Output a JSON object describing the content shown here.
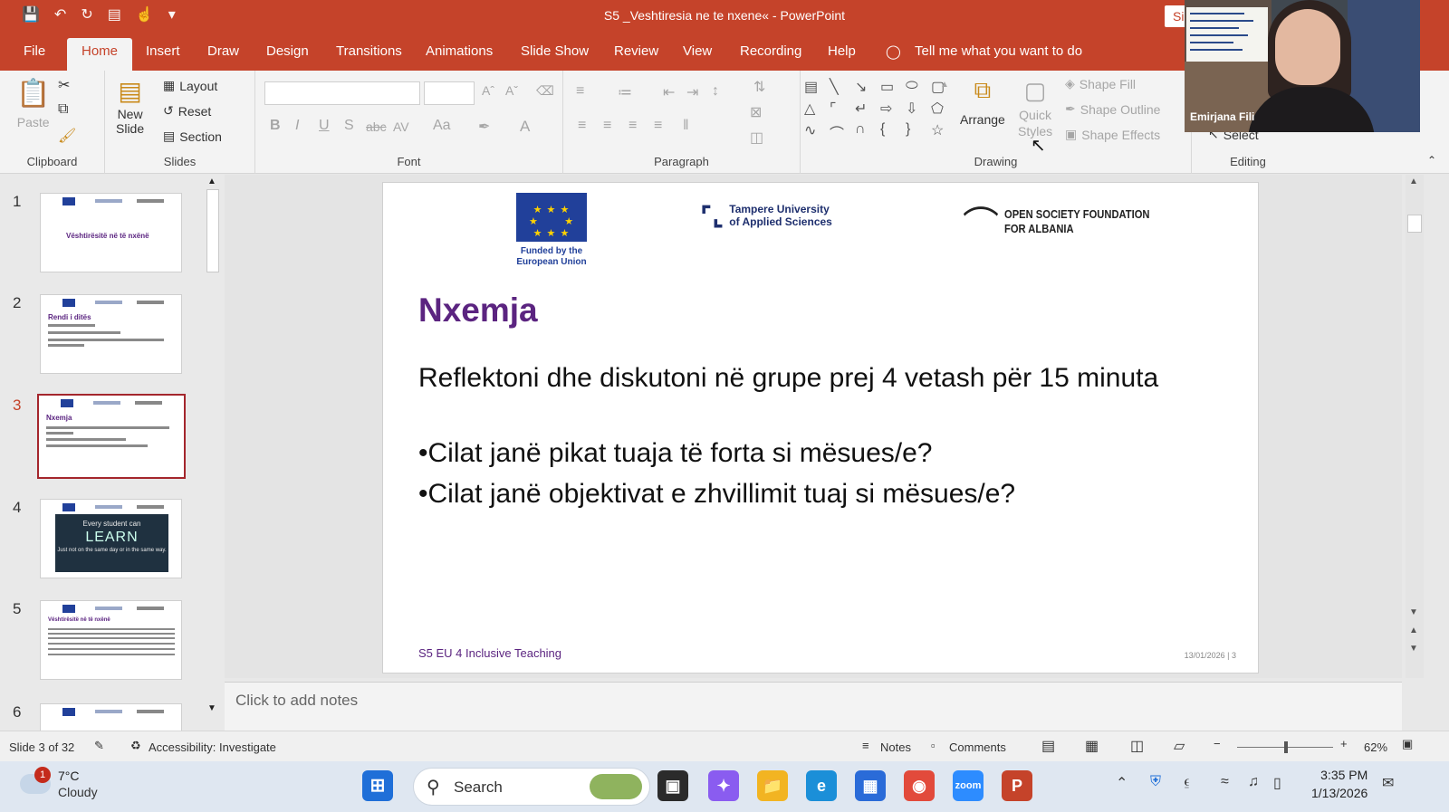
{
  "window": {
    "title": "S5 _Veshtiresia ne te nxene«  -  PowerPoint",
    "sign_in": "Sign"
  },
  "tabs": [
    "File",
    "Home",
    "Insert",
    "Draw",
    "Design",
    "Transitions",
    "Animations",
    "Slide Show",
    "Review",
    "View",
    "Recording",
    "Help"
  ],
  "tell_me": "Tell me what you want to do",
  "ribbon": {
    "clipboard": {
      "label": "Clipboard",
      "paste": "Paste"
    },
    "slides": {
      "label": "Slides",
      "new_slide": "New",
      "new_slide2": "Slide",
      "layout": "Layout",
      "reset": "Reset",
      "section": "Section"
    },
    "font": {
      "label": "Font",
      "bold": "B",
      "italic": "I",
      "underline": "U",
      "shadow": "S",
      "strike": "abc",
      "spacing": "AV",
      "case": "Aa",
      "color": "A"
    },
    "paragraph": {
      "label": "Paragraph"
    },
    "drawing": {
      "label": "Drawing",
      "arrange": "Arrange",
      "quick": "Quick",
      "styles": "Styles",
      "shape_fill": "Shape Fill",
      "shape_outline": "Shape Outline",
      "shape_effects": "Shape Effects"
    },
    "editing": {
      "label": "Editing",
      "select": "Select"
    }
  },
  "thumbnails": [
    {
      "num": "1",
      "title": "Vështirësitë në të nxënë"
    },
    {
      "num": "2",
      "title": "Rendi i ditës"
    },
    {
      "num": "3",
      "title": "Nxemja"
    },
    {
      "num": "4",
      "title": "Every student can",
      "big": "LEARN",
      "sub": "Just not on the same day or in the same way."
    },
    {
      "num": "5",
      "title": "Vështirësitë në të nxënë"
    },
    {
      "num": "6",
      "title": ""
    }
  ],
  "slide": {
    "eu_caption_1": "Funded by the",
    "eu_caption_2": "European Union",
    "tamk_1": "Tampere University",
    "tamk_2": "of Applied Sciences",
    "osf_1": "OPEN SOCIETY FOUNDATION",
    "osf_2": "FOR ALBANIA",
    "title": "Nxemja",
    "body": "Reflektoni dhe diskutoni në grupe prej 4 vetash për 15 minuta",
    "bullets": [
      "•Cilat janë pikat tuaja të forta si mësues/e?",
      "•Cilat janë objektivat e zhvillimit tuaj si mësues/e?"
    ],
    "footer": "S5 EU 4 Inclusive Teaching",
    "date_page": "13/01/2026  |  3"
  },
  "notes_placeholder": "Click to add notes",
  "status": {
    "slide_count": "Slide 3 of 32",
    "accessibility": "Accessibility: Investigate",
    "notes": "Notes",
    "comments": "Comments",
    "zoom": "62%"
  },
  "taskbar": {
    "temp": "7°C",
    "condition": "Cloudy",
    "badge": "1",
    "search": "Search",
    "time": "3:35 PM",
    "date": "1/13/2026"
  },
  "video": {
    "participant": "Emirjana Fili"
  },
  "colors": {
    "accent": "#c5432a",
    "slide_title": "#5b2480",
    "eu_blue": "#21409a"
  }
}
